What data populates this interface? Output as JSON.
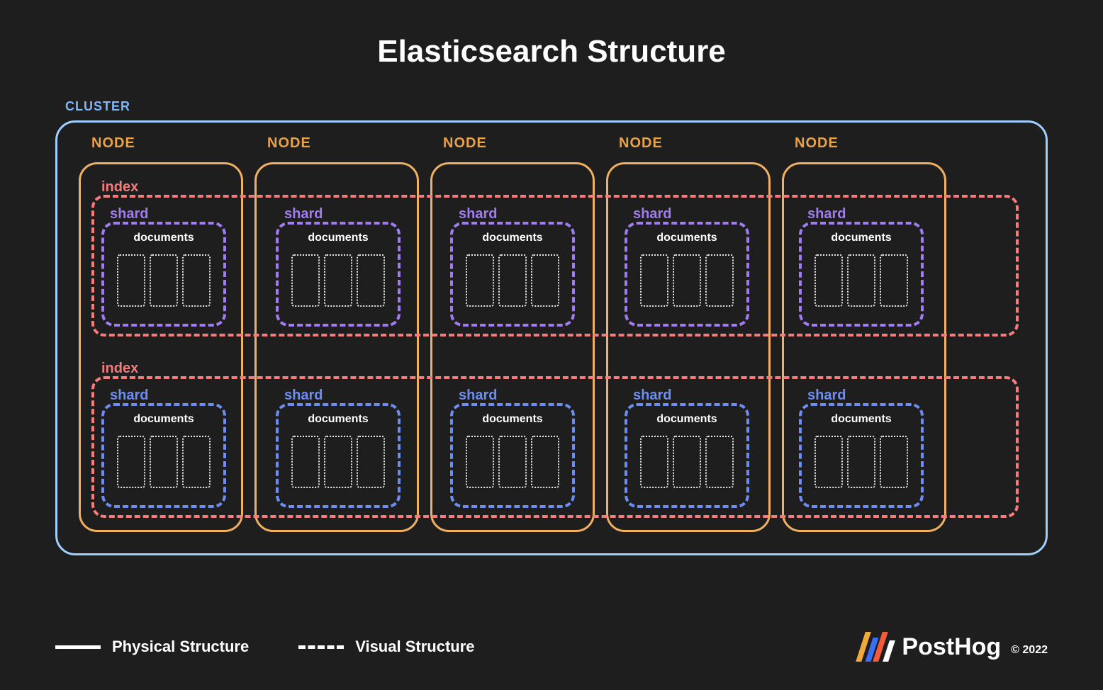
{
  "title": "Elasticsearch Structure",
  "cluster_label": "CLUSTER",
  "node_label": "NODE",
  "index_label": "index",
  "shard_label": "shard",
  "documents_label": "documents",
  "legend": {
    "physical": "Physical  Structure",
    "visual": "Visual Structure"
  },
  "brand": {
    "name": "PostHog",
    "copyright": "© 2022"
  },
  "layout": {
    "nodes": 5,
    "indices_per_cluster": 2,
    "shards_per_index": 5,
    "documents_per_shard": 3,
    "colors": {
      "cluster_border": "#9dcfff",
      "node_border": "#f0b060",
      "index_border": "#f47c7c",
      "shard_row1": "#a07cf0",
      "shard_row2": "#6d8ef0"
    }
  }
}
